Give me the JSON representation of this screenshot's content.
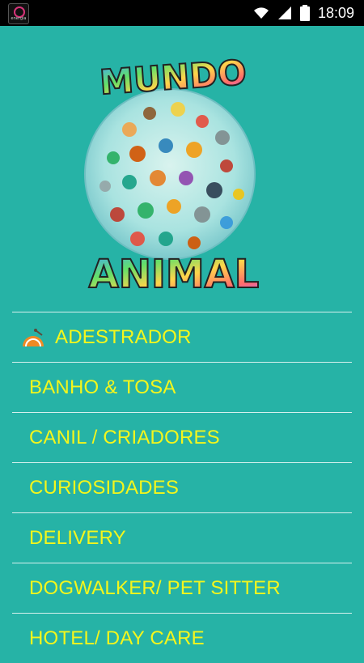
{
  "status_bar": {
    "app_icon_text": "energia",
    "time": "18:09"
  },
  "logo": {
    "top_text": "MUNDO",
    "bottom_text": "ANIMAL"
  },
  "menu": {
    "items": [
      {
        "label": "ADESTRADOR"
      },
      {
        "label": "BANHO & TOSA"
      },
      {
        "label": "CANIL / CRIADORES"
      },
      {
        "label": "CURIOSIDADES"
      },
      {
        "label": "DELIVERY"
      },
      {
        "label": "DOGWALKER/ PET SITTER"
      },
      {
        "label": "HOTEL/ DAY CARE"
      }
    ]
  },
  "colors": {
    "background": "#26b3a6",
    "menu_text": "#f4f61c",
    "divider": "#d6f1ee",
    "statusbar": "#000000"
  }
}
